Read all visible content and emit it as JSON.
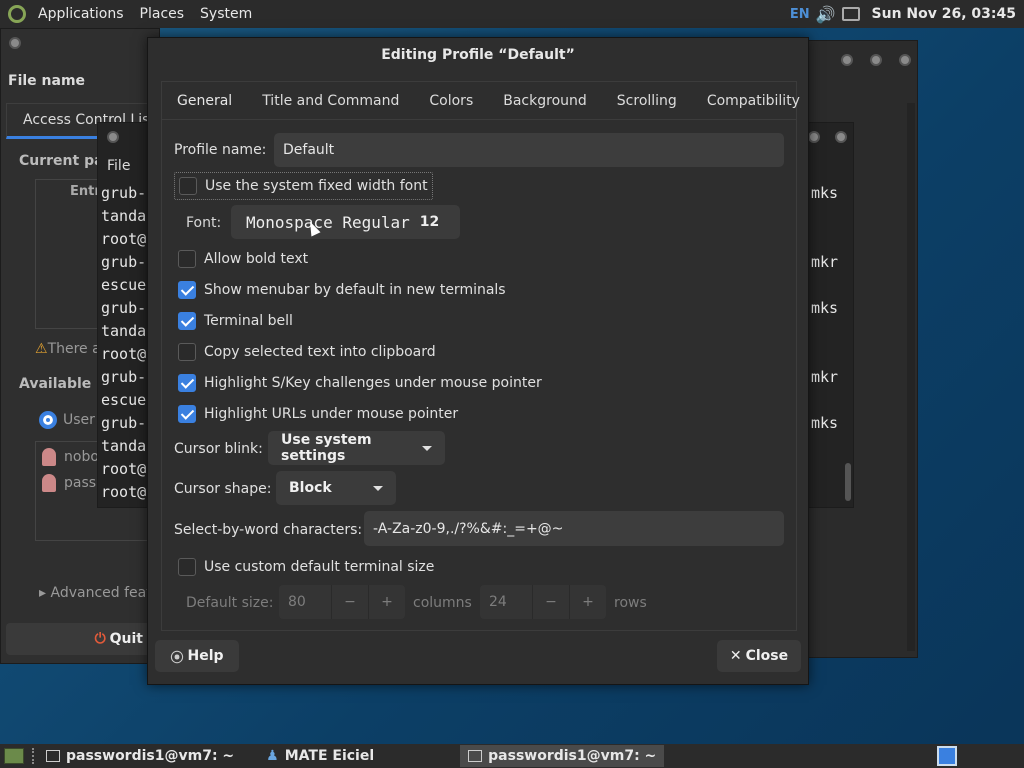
{
  "topbar": {
    "applications": "Applications",
    "places": "Places",
    "system": "System",
    "lang": "EN",
    "clock": "Sun Nov 26, 03:45",
    "icons": [
      "mate-logo-icon",
      "keyboard-layout-indicator",
      "volume-icon",
      "network-icon"
    ]
  },
  "bg_window_left": {
    "filename_label": "File name",
    "tab": "Access Control List",
    "current_part": "Current part",
    "entry_header": "Entr",
    "warning": "There a",
    "available": "Available pa",
    "user_radio": "User",
    "users": [
      "nobo",
      "pass"
    ],
    "advanced": "Advanced featu",
    "quit": "Quit"
  },
  "terminal": {
    "menu": "File",
    "lines": [
      "grub-",
      "tanda",
      "root@",
      "grub-",
      "escue",
      "grub-",
      "tanda",
      "root@",
      "grub-",
      "escue",
      "grub-",
      "tanda",
      "root@",
      "root@"
    ],
    "right_lines": [
      "mks",
      "mkr",
      "mks",
      "mkr",
      "mks"
    ]
  },
  "dialog": {
    "title": "Editing Profile “Default”",
    "tabs": [
      "General",
      "Title and Command",
      "Colors",
      "Background",
      "Scrolling",
      "Compatibility"
    ],
    "profile_name_label": "Profile name:",
    "profile_name_value": "Default",
    "use_system_font": "Use the system fixed width font",
    "use_system_font_checked": false,
    "font_label": "Font:",
    "font_name": "Monospace Regular",
    "font_size": "12",
    "checks": [
      {
        "label": "Allow bold text",
        "checked": false
      },
      {
        "label": "Show menubar by default in new terminals",
        "checked": true
      },
      {
        "label": "Terminal bell",
        "checked": true
      },
      {
        "label": "Copy selected text into clipboard",
        "checked": false
      },
      {
        "label": "Highlight S/Key challenges under mouse pointer",
        "checked": true
      },
      {
        "label": "Highlight URLs under mouse pointer",
        "checked": true
      }
    ],
    "cursor_blink_label": "Cursor blink:",
    "cursor_blink_value": "Use system settings",
    "cursor_shape_label": "Cursor shape:",
    "cursor_shape_value": "Block",
    "select_word_label": "Select-by-word characters:",
    "select_word_value": "-A-Za-z0-9,./?%&#:_=+@~",
    "custom_size_label": "Use custom default terminal size",
    "custom_size_checked": false,
    "default_size_label": "Default size:",
    "columns_value": "80",
    "columns_label": "columns",
    "rows_value": "24",
    "rows_label": "rows",
    "minus": "−",
    "plus": "+",
    "help": "Help",
    "close": "Close"
  },
  "taskbar": [
    {
      "label": "passwordis1@vm7: ~",
      "active": false
    },
    {
      "label": "MATE Eiciel",
      "active": false
    },
    {
      "label": "passwordis1@vm7: ~",
      "active": true
    }
  ]
}
